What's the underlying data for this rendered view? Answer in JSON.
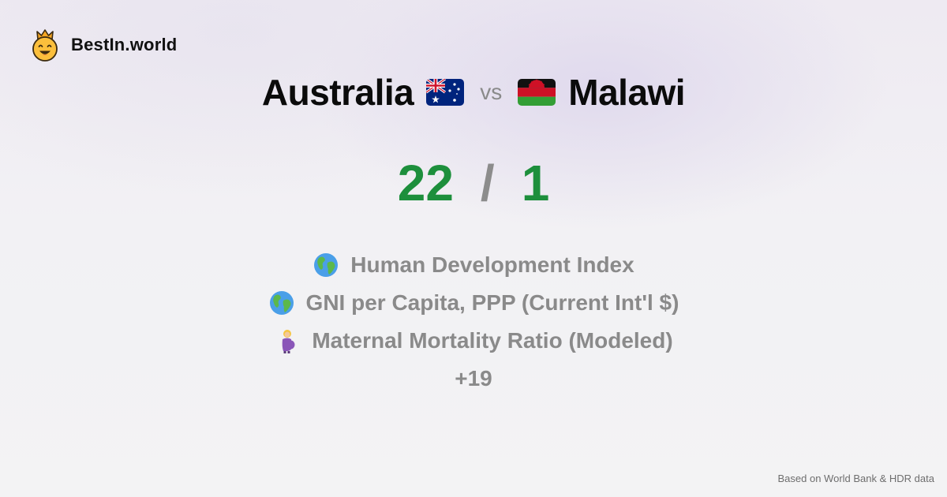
{
  "brand": {
    "name": "BestIn.world",
    "logo_icon": "crowned-smiley-icon"
  },
  "comparison": {
    "left_country": "Australia",
    "left_flag": "australia-flag-icon",
    "vs_label": "vs",
    "right_country": "Malawi",
    "right_flag": "malawi-flag-icon"
  },
  "score": {
    "left": "22",
    "separator": "/",
    "right": "1",
    "color": "#1d8f3c"
  },
  "metrics": [
    {
      "icon": "globe-icon",
      "label": "Human Development Index"
    },
    {
      "icon": "globe-icon",
      "label": "GNI per Capita, PPP (Current Int'l $)"
    },
    {
      "icon": "pregnant-woman-icon",
      "label": "Maternal Mortality Ratio (Modeled)"
    }
  ],
  "more_label": "+19",
  "footer": {
    "source": "Based on World Bank & HDR data"
  }
}
